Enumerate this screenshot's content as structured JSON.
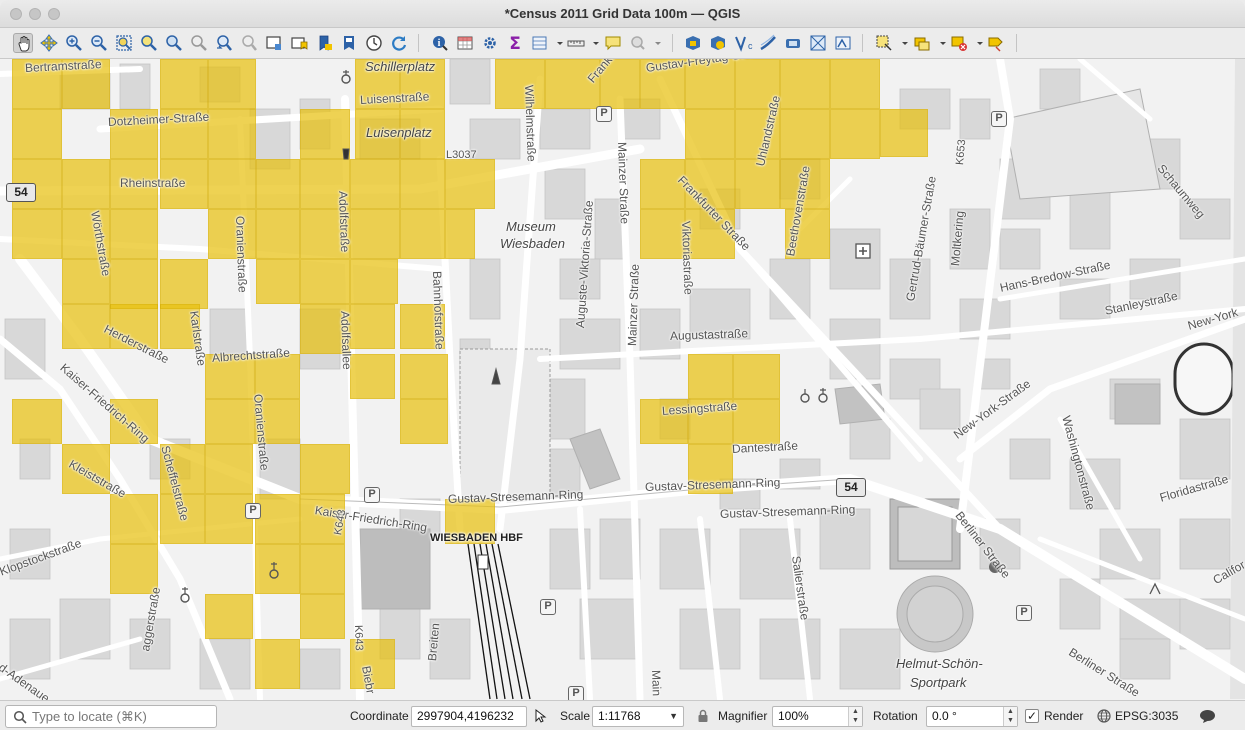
{
  "window": {
    "title": "*Census 2011 Grid Data 100m — QGIS"
  },
  "toolbar": {
    "buttons": [
      "pan-icon",
      "pan-to-selection-icon",
      "zoom-in-icon",
      "zoom-out-icon",
      "zoom-full-icon",
      "zoom-to-selection-icon",
      "zoom-to-layer-icon",
      "zoom-native-icon",
      "zoom-last-icon",
      "zoom-next-icon",
      "new-bookmark-icon",
      "show-bookmarks-icon",
      "new-map-view-icon",
      "temporal-controller-icon",
      "refresh-icon",
      "identify-icon",
      "attribute-table-icon",
      "processing-toolbox-icon",
      "statistics-icon",
      "open-field-calculator-icon",
      "measure-icon",
      "annotation-icon",
      "map-tips-icon",
      "plugin-a-icon",
      "plugin-b-icon",
      "plugin-c-icon",
      "plugin-d-icon",
      "plugin-e-icon",
      "plugin-f-icon",
      "plugin-g-icon",
      "select-features-icon",
      "select-by-value-icon",
      "deselect-icon",
      "label-icon"
    ]
  },
  "map": {
    "labels": {
      "bertramstrasse": "Bertramstraße",
      "schillerplatz": "Schillerplatz",
      "luisenstrasse": "Luisenstraße",
      "luisenplatz": "Luisenplatz",
      "dotzheimer": "Dotzheimer-Straße",
      "rheinstrasse": "Rheinstraße",
      "l3037": "L3037",
      "woerthstrasse": "Wörthstraße",
      "oranienstrasse": "Oranienstraße",
      "adolfstrasse": "Adolfstraße",
      "bahnhofstrasse": "Bahnhofstraße",
      "karlstrasse": "Karlstraße",
      "herderstrasse": "Herderstraße",
      "albrechtstrasse": "Albrechtstraße",
      "adolfsallee": "Adolfsallee",
      "kaiser_friedrich_ring": "Kaiser-Friedrich-Ring",
      "kaiser_friedrich_ring2": "Kaiser-Friedrich-Ring",
      "oranienstrasse2": "Oranienstraße",
      "kleiststrasse": "Kleiststraße",
      "scheffelstrasse": "Scheffelstraße",
      "klopstockstrasse": "Klopstockstraße",
      "wilhelmstrasse": "Wilhelmstraße",
      "museum": "Museum\nWiesbaden",
      "museum1": "Museum",
      "museum2": "Wiesbaden",
      "gustav_freytag": "Gustav-Freytag-Straße",
      "frankfurter_strasse": "Frankfurter Straße",
      "frankfurter_strasse2": "Frankfurter Straße",
      "mainzer_strasse": "Mainzer Straße",
      "mainzer_strasse2": "Mainzer Straße",
      "viktoriastrasse": "Viktoriastraße",
      "uhlandstrasse": "Uhlandstraße",
      "beethovenstrasse": "Beethovenstraße",
      "gertrud_baeumer": "Gertrud-Bäumer-Straße",
      "moltkering": "Moltkering",
      "k653": "K653",
      "schaumweg": "Schaumweg",
      "hans_bredow": "Hans-Bredow-Straße",
      "stanleystrasse": "Stanleystraße",
      "new_york1": "New-York",
      "new_york2": "New-York-Straße",
      "auguste_viktoria": "Auguste-Viktoria-Straße",
      "augustastrasse": "Augustastraße",
      "lessingstrasse": "Lessingstraße",
      "dantestrasse": "Dantestraße",
      "gustav_stresemann1": "Gustav-Stresemann-Ring",
      "gustav_stresemann2": "Gustav-Stresemann-Ring",
      "gustav_stresemann3": "Gustav-Stresemann-Ring",
      "washingtonstrasse": "Washingtonstraße",
      "floridastrasse": "Floridastraße",
      "berliner1": "Berliner Straße",
      "berliner2": "Berliner Straße",
      "wiesbaden_hbf": "WIESBADEN HBF",
      "salierstrasse": "Salierstraße",
      "helmut1": "Helmut-Schön-",
      "helmut2": "Sportpark",
      "k643a": "K643",
      "k643b": "K643",
      "biebricher": "Biebr",
      "breiten": "Breiten",
      "aggerstrasse": "aggerstraße",
      "adenaue": "d-Adenaue",
      "califor": "Califor",
      "mainz3": "Main"
    },
    "shields": {
      "r54a": "54",
      "r54b": "54"
    }
  },
  "statusbar": {
    "locate_placeholder": "Type to locate (⌘K)",
    "coordinate_label": "Coordinate",
    "coordinate_value": "2997904,4196232",
    "scale_label": "Scale",
    "scale_value": "1:11768",
    "magnifier_label": "Magnifier",
    "magnifier_value": "100%",
    "rotation_label": "Rotation",
    "rotation_value": "0.0 °",
    "render_label": "Render",
    "render_checked": true,
    "crs_label": "EPSG:3035"
  },
  "colors": {
    "grid_fill": "#e8c110",
    "map_background": "#f2f2f2",
    "building": "#d3d3d3",
    "road": "#ffffff"
  }
}
